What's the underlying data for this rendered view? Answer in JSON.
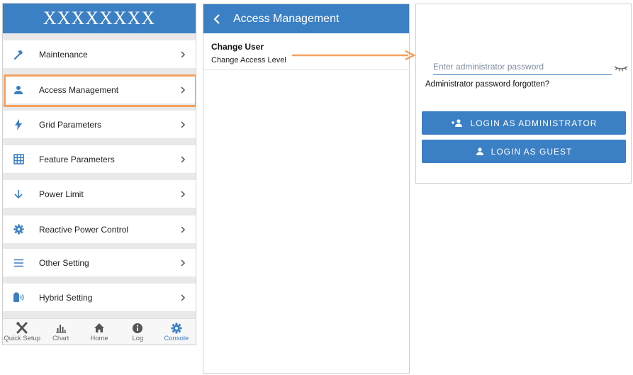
{
  "console": {
    "title": "XXXXXXXX",
    "menu": [
      {
        "label": "Maintenance",
        "icon": "hammer-icon"
      },
      {
        "label": "Access Management",
        "icon": "user-icon"
      },
      {
        "label": "Grid Parameters",
        "icon": "lightning-icon"
      },
      {
        "label": "Feature Parameters",
        "icon": "grid-icon"
      },
      {
        "label": "Power Limit",
        "icon": "arrow-down-icon"
      },
      {
        "label": "Reactive Power Control",
        "icon": "gear-icon"
      },
      {
        "label": "Other Setting",
        "icon": "menu-lines-icon"
      },
      {
        "label": "Hybrid Setting",
        "icon": "battery-icon"
      }
    ],
    "tabs": [
      {
        "label": "Quick Setup",
        "icon": "tools-icon"
      },
      {
        "label": "Chart",
        "icon": "bar-chart-icon"
      },
      {
        "label": "Home",
        "icon": "home-icon"
      },
      {
        "label": "Log",
        "icon": "info-icon"
      },
      {
        "label": "Console",
        "icon": "gear-icon"
      }
    ],
    "active_tab": "Console",
    "highlight_color": "#f3a15e"
  },
  "access": {
    "title": "Access Management",
    "items": [
      "Change User",
      "Change Access Level"
    ]
  },
  "login": {
    "password_placeholder": "Enter administrator password",
    "forgot_text": "Administrator password forgotten?",
    "admin_button": "LOGIN AS ADMINISTRATOR",
    "guest_button": "LOGIN AS GUEST"
  },
  "colors": {
    "accent": "#3b7fc4",
    "arrow": "#f3a15e"
  }
}
